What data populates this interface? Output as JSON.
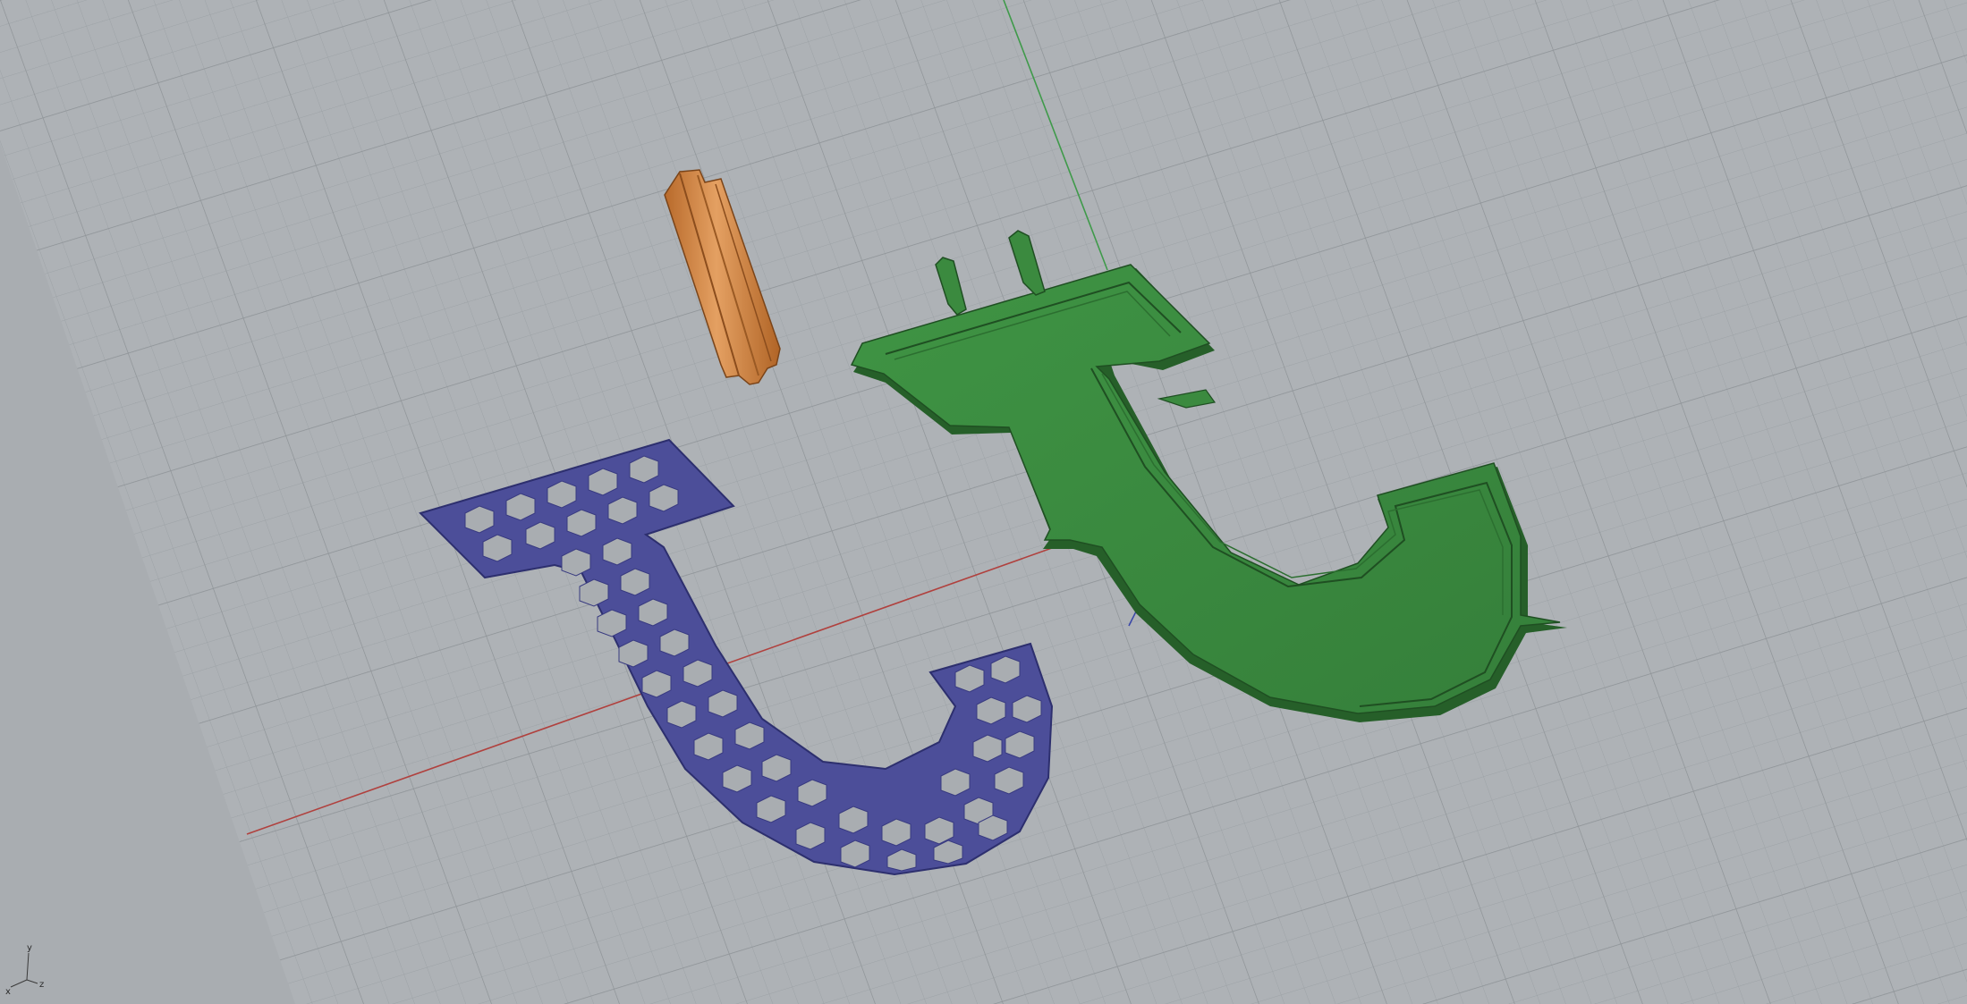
{
  "viewport": {
    "view_type": "perspective-3d",
    "grid": true,
    "colors": {
      "background": "#a9adb1",
      "grid_minor": "#9fa4a8",
      "grid_major": "#8d9296",
      "x_axis": "#b0413e",
      "y_axis": "#3f9a4a",
      "z_axis": "#3b48a8"
    }
  },
  "objects": [
    {
      "id": "honeycomb-hook-part",
      "shape": "j-hook-lattice",
      "color": "#4c4e99"
    },
    {
      "id": "solid-hook-part",
      "shape": "j-hook-solid",
      "color": "#3b8a3f"
    },
    {
      "id": "clip-part",
      "shape": "curved-clip",
      "color": "#d78a46"
    }
  ],
  "axis_widget": {
    "y_label": "y",
    "x_label": "x",
    "z_label": "z"
  }
}
